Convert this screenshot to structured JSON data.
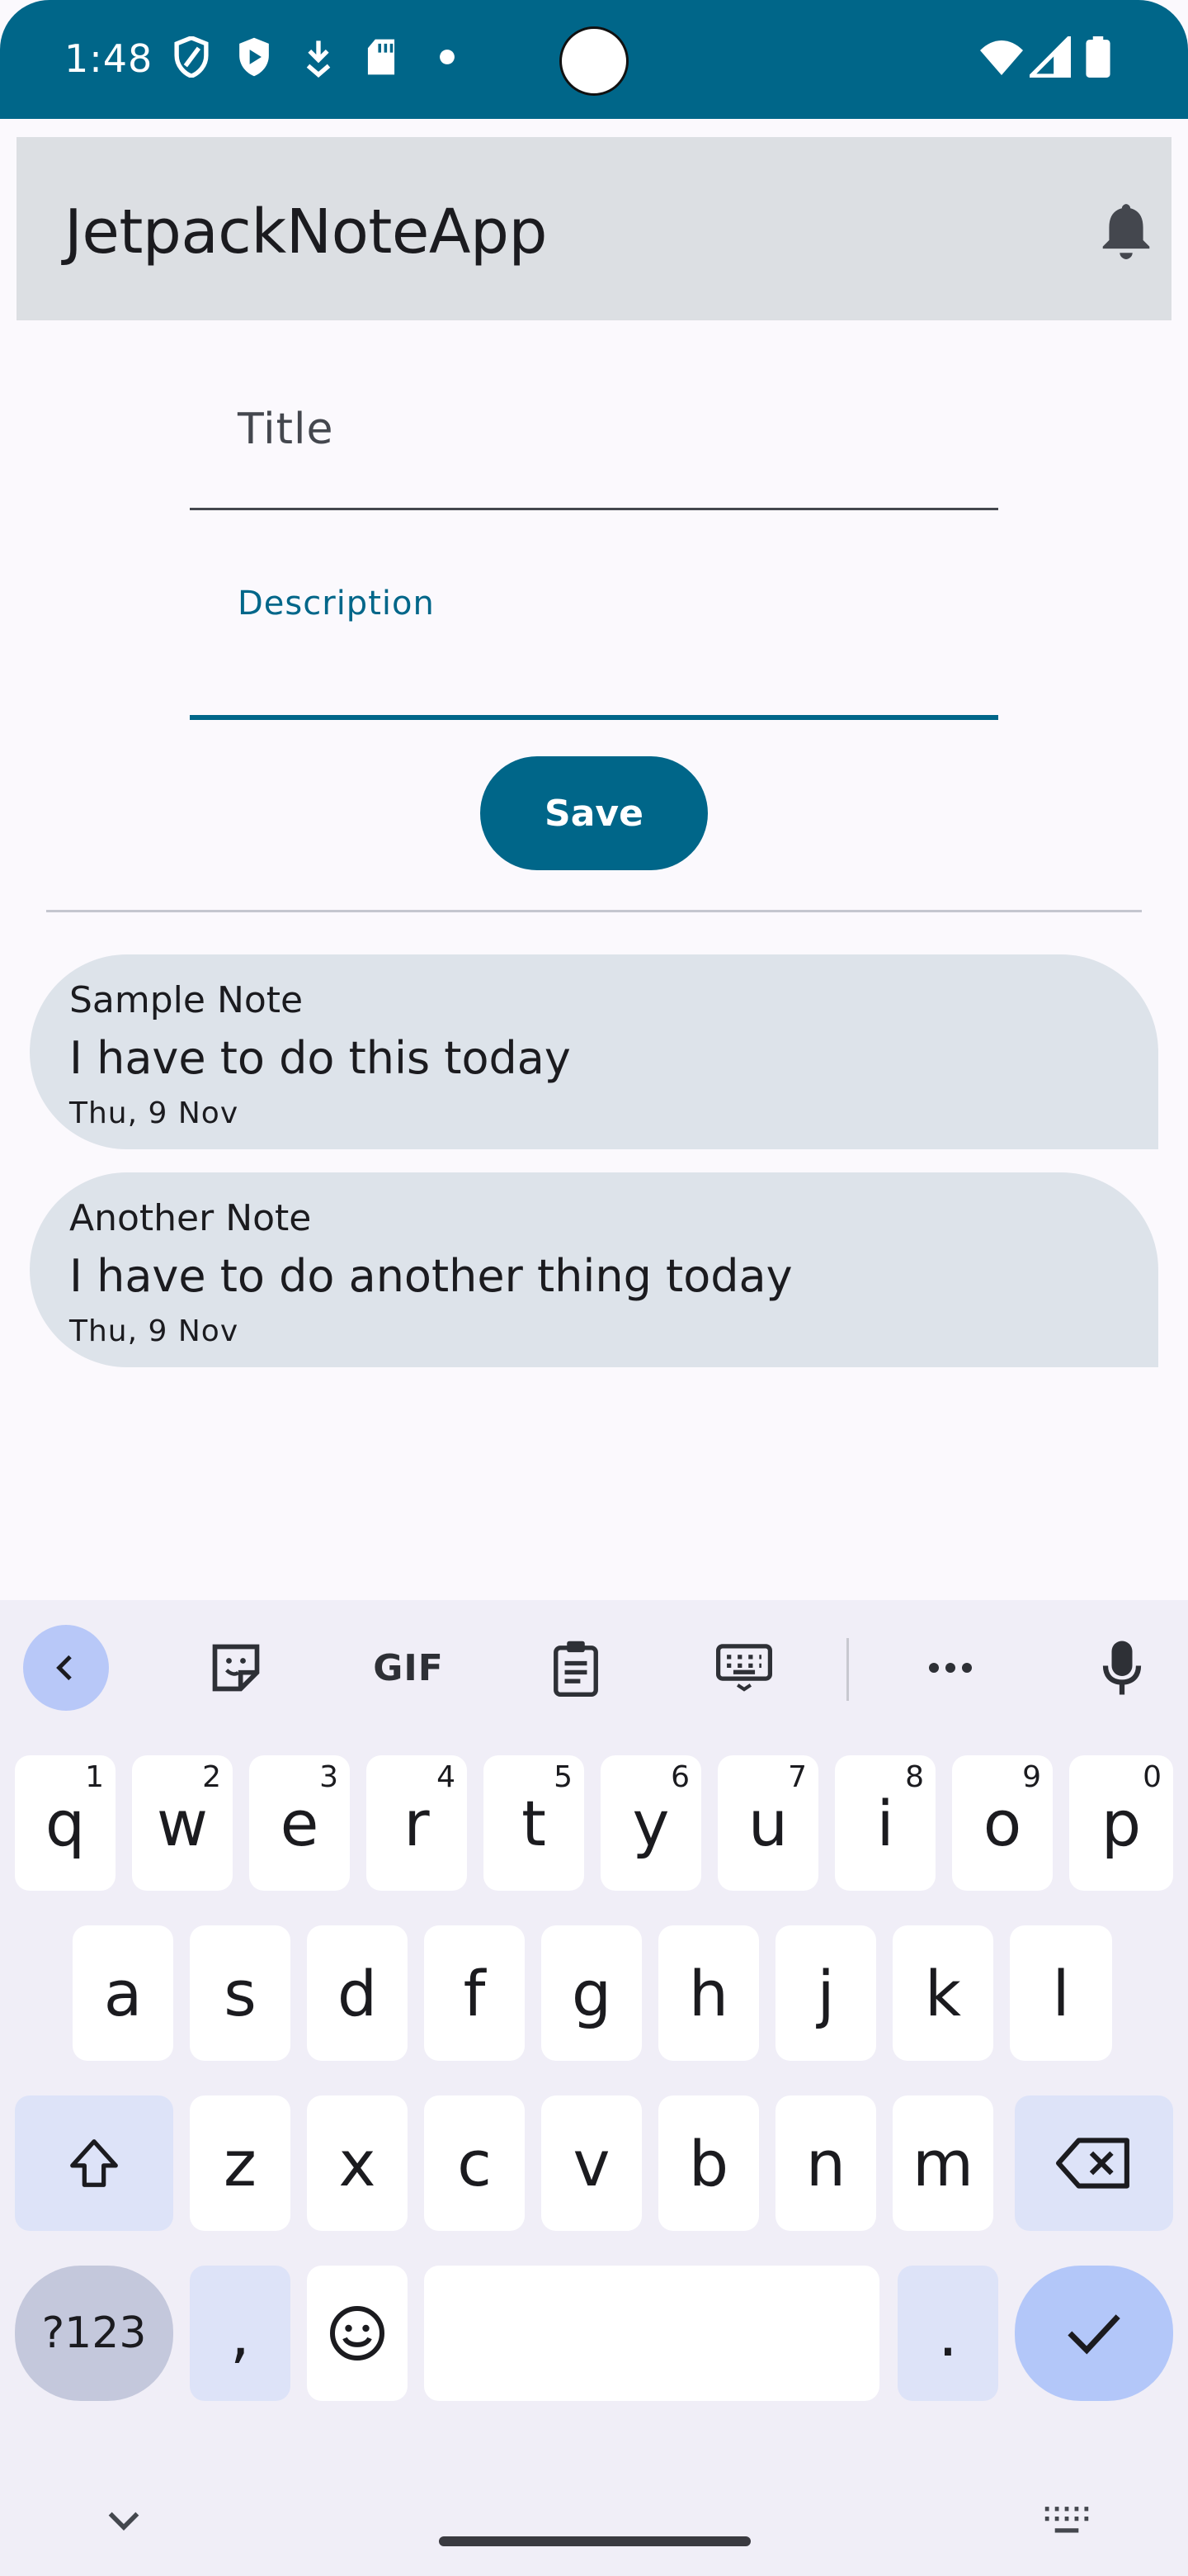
{
  "status_bar": {
    "time": "1:48",
    "bg_color": "#006689",
    "left_icons": [
      "shield-icon",
      "play-protect-icon",
      "download-icon",
      "sd-card-icon",
      "dot-icon"
    ],
    "right_icons": [
      "wifi-icon",
      "signal-icon",
      "battery-icon"
    ]
  },
  "app_bar": {
    "title": "JetpackNoteApp",
    "action_icon": "bell-icon"
  },
  "form": {
    "title_placeholder": "Title",
    "description_label": "Description",
    "save_label": "Save",
    "accent_color": "#006689"
  },
  "notes": [
    {
      "title": "Sample Note",
      "description": "I have to do this today",
      "date": "Thu, 9 Nov"
    },
    {
      "title": "Another Note",
      "description": "I have to do another thing today",
      "date": "Thu, 9 Nov"
    }
  ],
  "keyboard": {
    "toolbar": {
      "back_icon": "chevron-left-icon",
      "sticker_icon": "sticker-icon",
      "gif_label": "GIF",
      "clipboard_icon": "clipboard-icon",
      "keyboard_icon": "keyboard-icon",
      "more_icon": "more-icon",
      "mic_icon": "mic-icon"
    },
    "row1": [
      {
        "k": "q",
        "h": "1"
      },
      {
        "k": "w",
        "h": "2"
      },
      {
        "k": "e",
        "h": "3"
      },
      {
        "k": "r",
        "h": "4"
      },
      {
        "k": "t",
        "h": "5"
      },
      {
        "k": "y",
        "h": "6"
      },
      {
        "k": "u",
        "h": "7"
      },
      {
        "k": "i",
        "h": "8"
      },
      {
        "k": "o",
        "h": "9"
      },
      {
        "k": "p",
        "h": "0"
      }
    ],
    "row2": [
      "a",
      "s",
      "d",
      "f",
      "g",
      "h",
      "j",
      "k",
      "l"
    ],
    "row3": [
      "z",
      "x",
      "c",
      "v",
      "b",
      "n",
      "m"
    ],
    "symbols_label": "?123",
    "comma_label": ",",
    "period_label": "."
  }
}
